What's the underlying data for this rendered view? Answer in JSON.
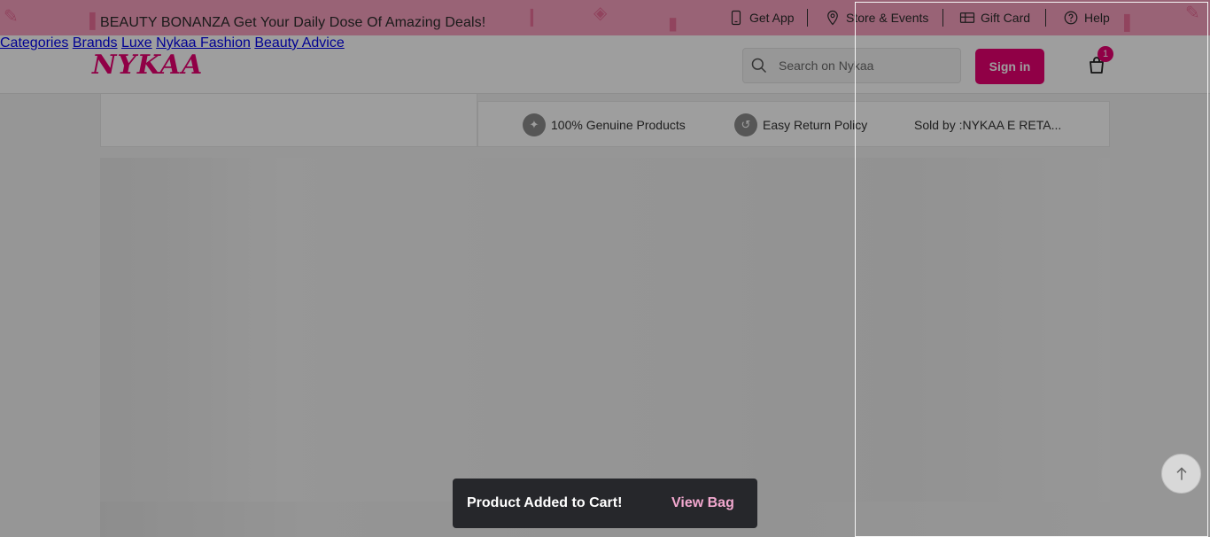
{
  "promo": {
    "text": "BEAUTY BONANZA Get Your Daily Dose Of Amazing Deals!"
  },
  "utility_links": [
    {
      "label": "Get App",
      "icon": "mobile-phone-icon"
    },
    {
      "label": "Store & Events",
      "icon": "location-pin-icon"
    },
    {
      "label": "Gift Card",
      "icon": "gift-card-icon"
    },
    {
      "label": "Help",
      "icon": "help-circle-icon"
    }
  ],
  "header": {
    "logo": "NYKAA",
    "nav": [
      "Categories",
      "Brands",
      "Luxe",
      "Nykaa Fashion",
      "Beauty Advice"
    ],
    "search_placeholder": "Search on Nykaa",
    "sign_in": "Sign in",
    "cart_count": "1"
  },
  "trust_bar": [
    {
      "label": "100% Genuine Products",
      "icon": "genuine-products-icon"
    },
    {
      "label": "Easy Return Policy",
      "icon": "return-arrow-icon"
    },
    {
      "label": "Sold by :NYKAA E RETA..."
    }
  ],
  "toast": {
    "message": "Product Added to Cart!",
    "action": "View Bag"
  },
  "colors": {
    "brand": "#e80071",
    "promo_bg": "#f7a1bf",
    "toast_bg": "#26272b",
    "toast_link": "#f2a8cf"
  }
}
